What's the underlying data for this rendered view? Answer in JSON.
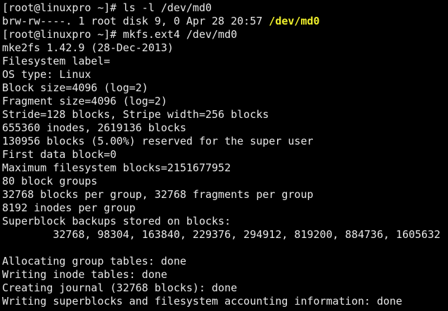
{
  "colors": {
    "background": "#000000",
    "foreground": "#e8e8e8",
    "block_device_highlight": "#f1f12c"
  },
  "terminal": {
    "lines": [
      "[root@linuxpro ~]# ls -l /dev/md0",
      {
        "prefix": "brw-rw----. 1 root disk 9, 0 Apr 28 20:57 ",
        "highlight": "/dev/md0"
      },
      "[root@linuxpro ~]# mkfs.ext4 /dev/md0",
      "mke2fs 1.42.9 (28-Dec-2013)",
      "Filesystem label=",
      "OS type: Linux",
      "Block size=4096 (log=2)",
      "Fragment size=4096 (log=2)",
      "Stride=128 blocks, Stripe width=256 blocks",
      "655360 inodes, 2619136 blocks",
      "130956 blocks (5.00%) reserved for the super user",
      "First data block=0",
      "Maximum filesystem blocks=2151677952",
      "80 block groups",
      "32768 blocks per group, 32768 fragments per group",
      "8192 inodes per group",
      "Superblock backups stored on blocks:",
      "\t32768, 98304, 163840, 229376, 294912, 819200, 884736, 1605632",
      "",
      "Allocating group tables: done",
      "Writing inode tables: done",
      "Creating journal (32768 blocks): done",
      "Writing superblocks and filesystem accounting information: done"
    ]
  }
}
